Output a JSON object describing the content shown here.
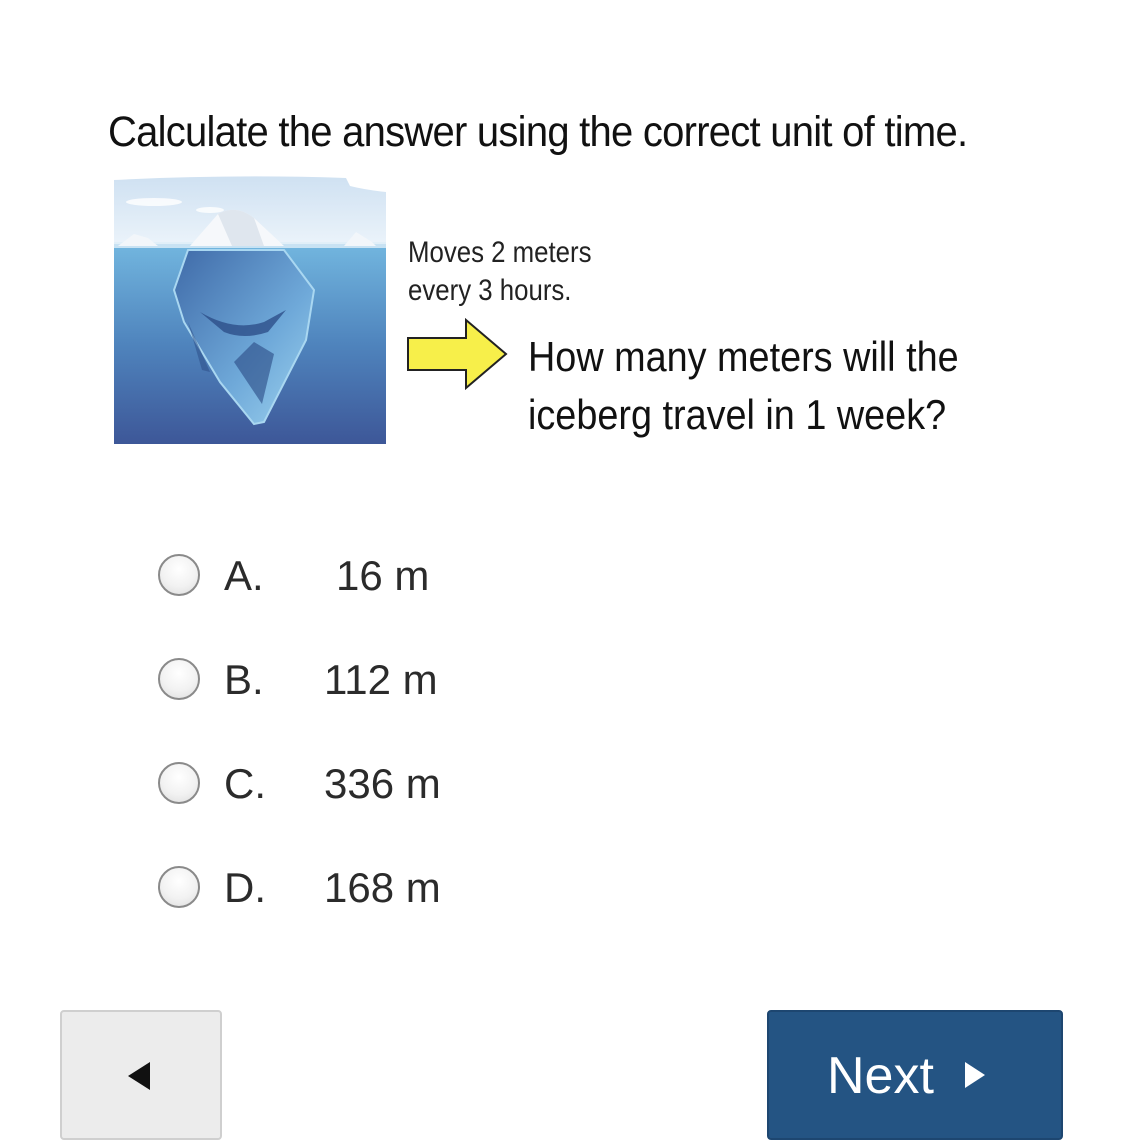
{
  "prompt": "Calculate the answer using the correct unit of time.",
  "figure": {
    "caption_line1": "Moves 2 meters",
    "caption_line2": "every 3 hours.",
    "question_line1": "How many meters will the",
    "question_line2": "iceberg travel in 1 week?",
    "arrow_color": "#f7ef4a",
    "water_colors": [
      "#6fb3dc",
      "#3f5d9b"
    ]
  },
  "choices": [
    {
      "letter": "A.",
      "value": "16 m"
    },
    {
      "letter": "B.",
      "value": "112 m"
    },
    {
      "letter": "C.",
      "value": "336 m"
    },
    {
      "letter": "D.",
      "value": "168 m"
    }
  ],
  "nav": {
    "previous_icon": "left-triangle-icon",
    "next_label": "Next",
    "next_icon": "right-triangle-icon",
    "next_color": "#245483"
  }
}
